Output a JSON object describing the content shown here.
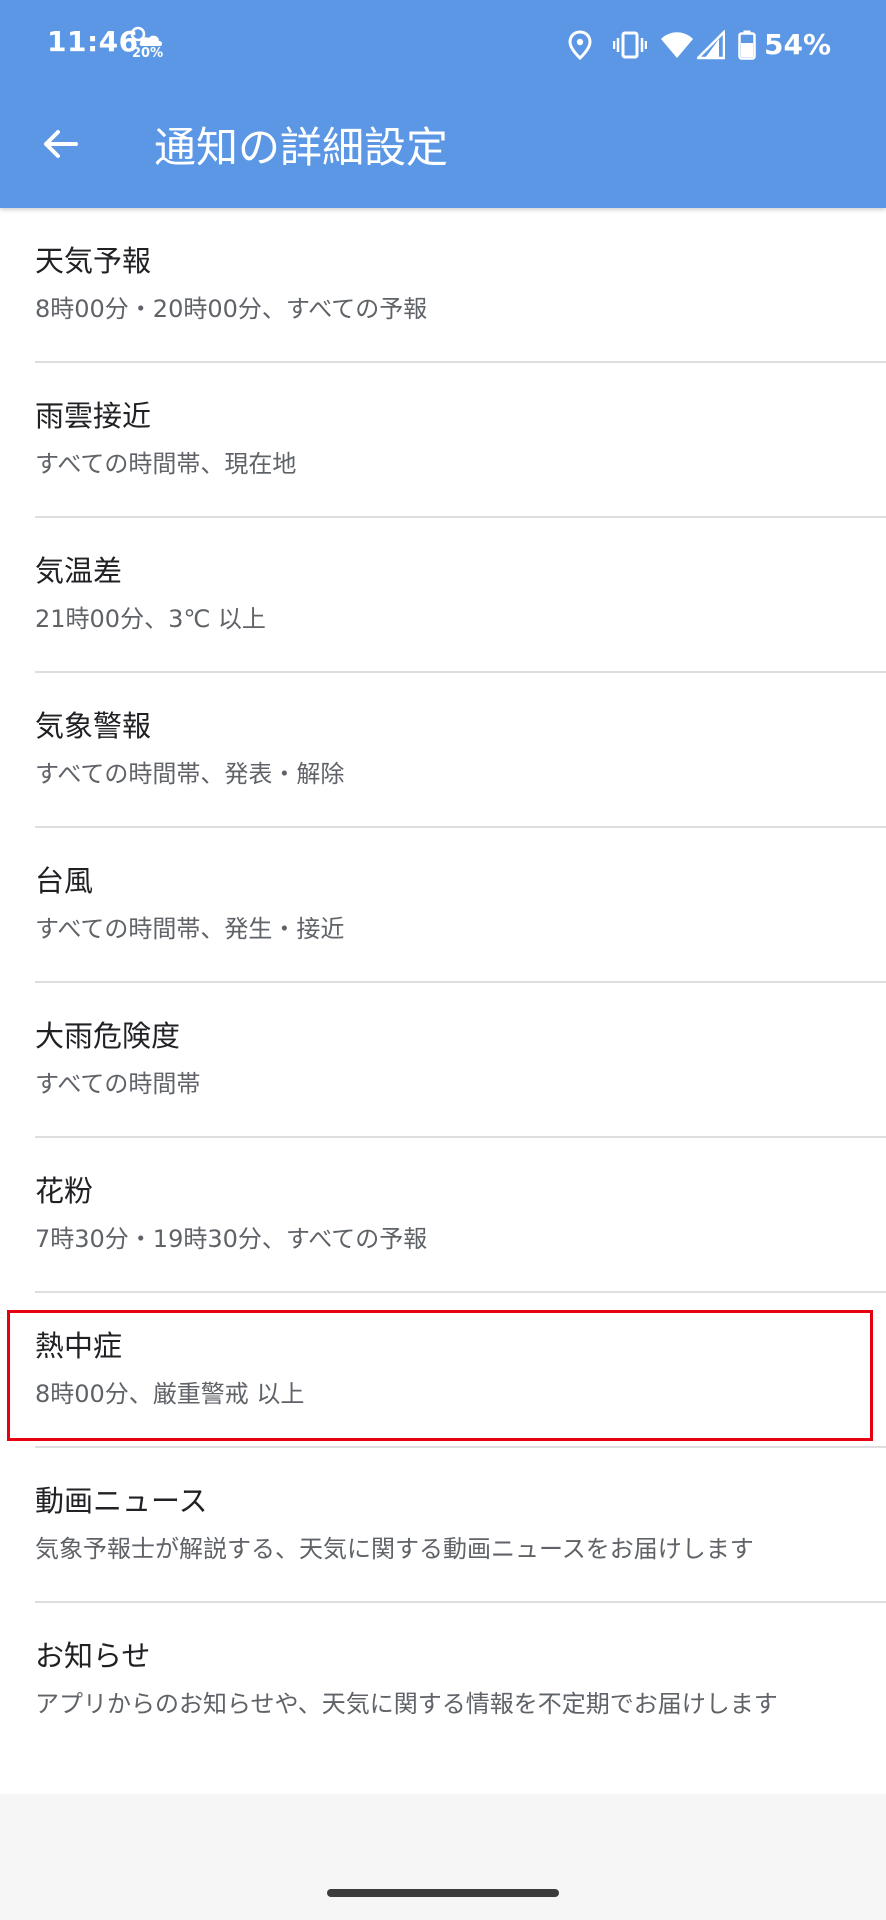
{
  "status_bar": {
    "time": "11:46",
    "weather_temp": "20%",
    "battery_percent": "54%",
    "icons": [
      "cloud-sun-icon",
      "location-icon",
      "vibrate-icon",
      "wifi-icon",
      "signal-icon",
      "battery-icon"
    ]
  },
  "toolbar": {
    "back_icon": "arrow-left-icon",
    "title": "通知の詳細設定"
  },
  "settings": [
    {
      "title": "天気予報",
      "subtitle": "8時00分・20時00分、すべての予報"
    },
    {
      "title": "雨雲接近",
      "subtitle": "すべての時間帯、現在地"
    },
    {
      "title": "気温差",
      "subtitle": "21時00分、3℃ 以上"
    },
    {
      "title": "気象警報",
      "subtitle": "すべての時間帯、発表・解除"
    },
    {
      "title": "台風",
      "subtitle": "すべての時間帯、発生・接近"
    },
    {
      "title": "大雨危険度",
      "subtitle": "すべての時間帯"
    },
    {
      "title": "花粉",
      "subtitle": "7時30分・19時30分、すべての予報"
    },
    {
      "title": "熱中症",
      "subtitle": "8時00分、厳重警戒 以上",
      "highlighted": true
    },
    {
      "title": "動画ニュース",
      "subtitle": "気象予報士が解説する、天気に関する動画ニュースをお届けします"
    },
    {
      "title": "お知らせ",
      "subtitle": "アプリからのお知らせや、天気に関する情報を不定期でお届けします"
    }
  ],
  "colors": {
    "app_bar": "#5b97e5",
    "highlight": "#e60012",
    "divider": "#dedede"
  }
}
